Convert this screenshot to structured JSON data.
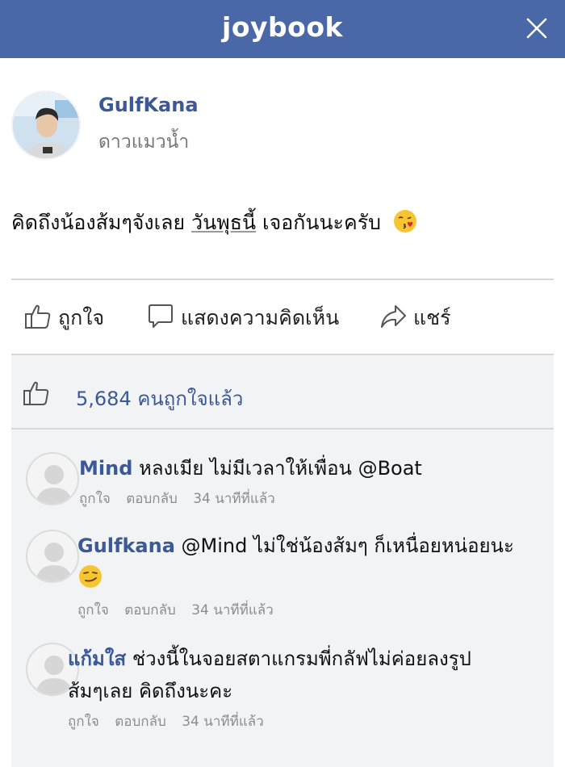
{
  "app": {
    "brand": "joybook",
    "close_icon": "close-icon"
  },
  "post": {
    "author": "GulfKana",
    "subtitle": "ดาวแมวน้ำ",
    "text_before": "คิดถึงน้องส้มๆจังเลย",
    "hashtag": "วันพุธนี้",
    "text_after": "เจอกันนะครับ"
  },
  "actions": {
    "like": "ถูกใจ",
    "comment": "แสดงความคิดเห็น",
    "share": "แชร์"
  },
  "likes": {
    "count_text": "5,684 คนถูกใจแล้ว"
  },
  "comments": [
    {
      "name": "Mind",
      "text": "หลงเมีย ไม่มีเวลาให้เพื่อน @Boat",
      "like": "ถูกใจ",
      "reply": "ตอบกลับ",
      "time": "34 นาทีที่แล้ว"
    },
    {
      "name": "Gulfkana",
      "text": "@Mind ไม่ใช่น้องส้มๆ ก็เหนื่อยหน่อยนะ",
      "like": "ถูกใจ",
      "reply": "ตอบกลับ",
      "time": "34 นาทีที่แล้ว"
    },
    {
      "name": "แก้มใส",
      "text": "ช่วงนี้ในจอยสตาแกรมพี่กลัฟไม่ค่อยลงรูป",
      "text_line2": "ส้มๆเลย คิดถึงนะคะ",
      "like": "ถูกใจ",
      "reply": "ตอบกลับ",
      "time": "34 นาทีที่แล้ว"
    }
  ]
}
